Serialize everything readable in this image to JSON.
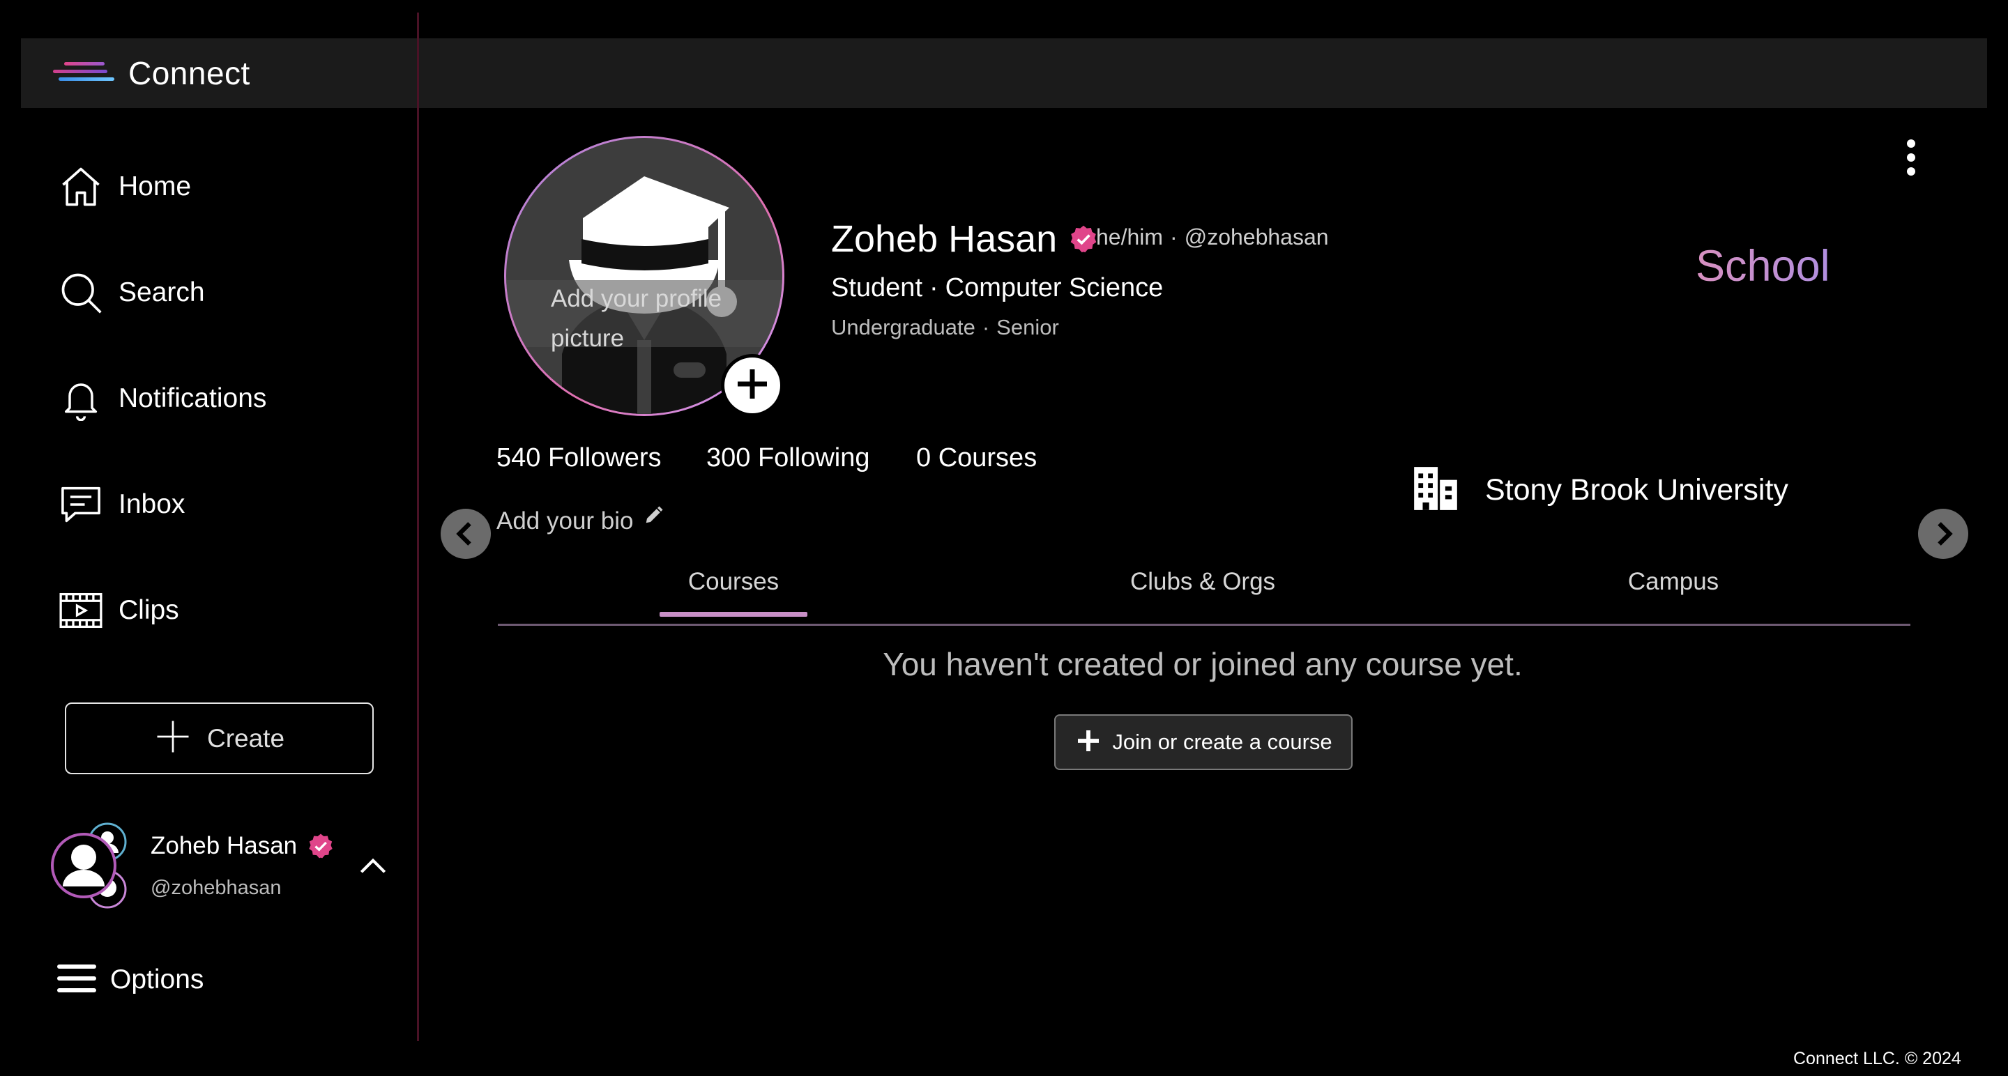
{
  "app": {
    "brand": "Connect",
    "colors": {
      "accent_pink": "#e0458a",
      "tab_underline": "#c88fc6",
      "school_gradient_start": "#d890c0",
      "school_gradient_end": "#b08fe0"
    }
  },
  "sidebar": {
    "items": [
      {
        "label": "Home",
        "icon": "home-icon"
      },
      {
        "label": "Search",
        "icon": "search-icon"
      },
      {
        "label": "Notifications",
        "icon": "bell-icon"
      },
      {
        "label": "Inbox",
        "icon": "chat-icon"
      },
      {
        "label": "Clips",
        "icon": "film-icon"
      }
    ],
    "create_label": "Create",
    "account": {
      "name": "Zoheb Hasan",
      "handle": "@zohebhasan"
    },
    "options_label": "Options"
  },
  "profile": {
    "add_photo_text": "Add your profile picture",
    "name": "Zoheb Hasan",
    "pronouns": "he/him",
    "handle": "@zohebhasan",
    "role": "Student",
    "major": "Computer Science",
    "program": "Undergraduate",
    "year": "Senior",
    "type_label": "School",
    "stats": {
      "followers": "540 Followers",
      "following": "300 Following",
      "courses": "0 Courses"
    },
    "bio_placeholder": "Add your bio",
    "university": "Stony Brook University"
  },
  "tabs": [
    {
      "label": "Courses",
      "active": true
    },
    {
      "label": "Clubs & Orgs",
      "active": false
    },
    {
      "label": "Campus",
      "active": false
    }
  ],
  "courses": {
    "empty_message": "You haven't created or joined any course yet.",
    "join_button": "Join or create a course"
  },
  "footer": {
    "copyright": "Connect LLC. © 2024"
  }
}
